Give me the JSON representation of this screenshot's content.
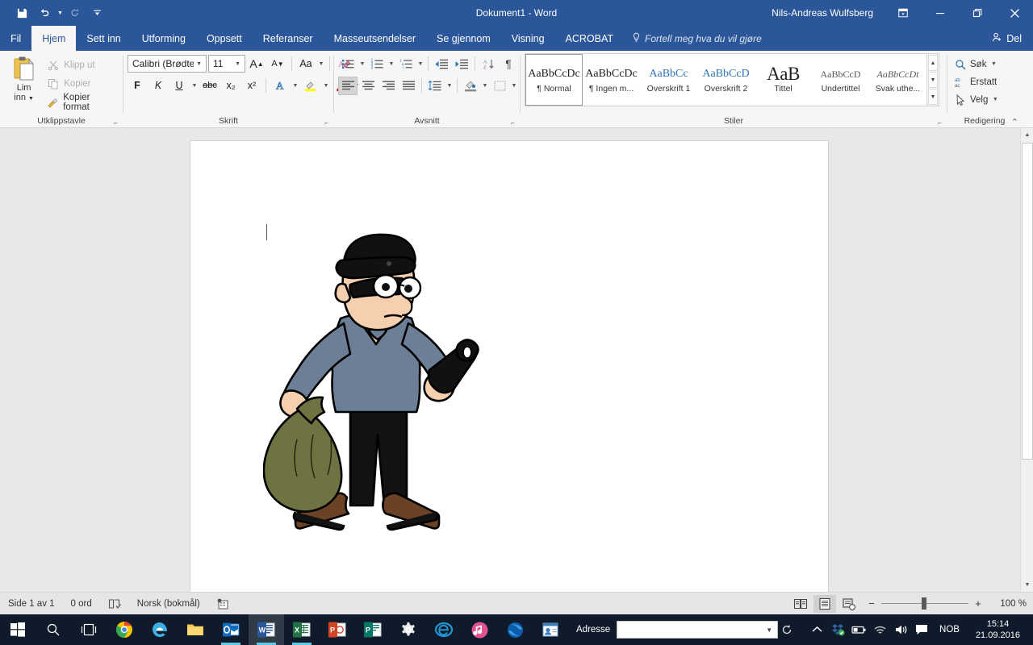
{
  "titlebar": {
    "document_title": "Dokument1 - Word",
    "user_name": "Nils-Andreas Wulfsberg",
    "qat": [
      {
        "name": "save",
        "label": "Lagre"
      },
      {
        "name": "undo",
        "label": "Angre"
      },
      {
        "name": "redo",
        "label": "Gjør om"
      },
      {
        "name": "customize",
        "label": "Tilpass verktøylinje for hurtigtilgang"
      }
    ],
    "window_buttons": [
      {
        "name": "ribbon-display-options",
        "label": "Alternativer for båndvisning"
      },
      {
        "name": "minimize",
        "label": "Minimer"
      },
      {
        "name": "restore",
        "label": "Gjenopprett"
      },
      {
        "name": "close",
        "label": "Lukk"
      }
    ]
  },
  "tabs": [
    {
      "label": "Fil",
      "active": false
    },
    {
      "label": "Hjem",
      "active": true
    },
    {
      "label": "Sett inn",
      "active": false
    },
    {
      "label": "Utforming",
      "active": false
    },
    {
      "label": "Oppsett",
      "active": false
    },
    {
      "label": "Referanser",
      "active": false
    },
    {
      "label": "Masseutsendelser",
      "active": false
    },
    {
      "label": "Se gjennom",
      "active": false
    },
    {
      "label": "Visning",
      "active": false
    },
    {
      "label": "ACROBAT",
      "active": false
    }
  ],
  "tell_me": "Fortell meg hva du vil gjøre",
  "share": "Del",
  "ribbon": {
    "clipboard": {
      "group_label": "Utklippstavle",
      "paste_label_line1": "Lim",
      "paste_label_line2": "inn",
      "cut": "Klipp ut",
      "copy": "Kopier",
      "format_painter": "Kopier format"
    },
    "font": {
      "group_label": "Skrift",
      "font_name": "Calibri (Brødte",
      "font_size": "11",
      "grow_font": "A",
      "shrink_font": "A",
      "change_case": "Aa",
      "clear_formatting": "Fjern all formatering",
      "bold": "F",
      "italic": "K",
      "underline": "U",
      "strikethrough": "abc",
      "subscript": "x₂",
      "superscript": "x²",
      "text_effects": "A",
      "highlight": "ab",
      "font_color": "A",
      "highlight_color": "#ffff00",
      "font_color_value": "#c00000"
    },
    "paragraph": {
      "group_label": "Avsnitt",
      "bullets": "Punktmerket liste",
      "numbering": "Nummerert liste",
      "multilevel": "Liste med flere nivåer",
      "decrease_indent": "Reduser innrykk",
      "increase_indent": "Øk innrykk",
      "sort": "Sorter",
      "show_marks": "¶",
      "align_left": "Venstrejuster",
      "align_center": "Midtstill",
      "align_right": "Høyrejuster",
      "justify": "Blokkjuster",
      "line_spacing": "Linje- og avsnittsavstand",
      "shading": "Skyggelegging",
      "borders": "Kantlinjer"
    },
    "styles": {
      "group_label": "Stiler",
      "items": [
        {
          "preview": "AaBbCcDc",
          "name": "¶ Normal",
          "style": "normal",
          "selected": true
        },
        {
          "preview": "AaBbCcDc",
          "name": "¶ Ingen m...",
          "style": "normal",
          "selected": false
        },
        {
          "preview": "AaBbCc",
          "name": "Overskrift 1",
          "style": "blue",
          "selected": false
        },
        {
          "preview": "AaBbCcD",
          "name": "Overskrift 2",
          "style": "blue",
          "selected": false
        },
        {
          "preview": "AaB",
          "name": "Tittel",
          "style": "big",
          "selected": false
        },
        {
          "preview": "AaBbCcD",
          "name": "Undertittel",
          "style": "gray",
          "selected": false
        },
        {
          "preview": "AaBbCcDt",
          "name": "Svak uthe...",
          "style": "ital",
          "selected": false
        }
      ],
      "scroll_up": "▲",
      "scroll_down": "▼",
      "more": "▾"
    },
    "editing": {
      "group_label": "Redigering",
      "find": "Søk",
      "replace": "Erstatt",
      "select": "Velg"
    },
    "collapse": "Skjul båndet"
  },
  "document": {
    "clipart_name": "burglar-with-sack-and-flashlight",
    "colors": {
      "hat": "#0d0d0d",
      "skin": "#f5cfae",
      "sweater": "#6d7f96",
      "pants": "#121212",
      "sack": "#6f7341",
      "shoes": "#6b4226",
      "flashlight": "#111111"
    }
  },
  "statusbar": {
    "page_info": "Side 1 av 1",
    "word_count": "0 ord",
    "proofing_icon": "proofing-errors-icon",
    "language": "Norsk (bokmål)",
    "macro_icon": "macro-record-icon",
    "views": [
      {
        "name": "read-mode",
        "selected": false
      },
      {
        "name": "print-layout",
        "selected": true
      },
      {
        "name": "web-layout",
        "selected": false
      }
    ],
    "zoom_out": "−",
    "zoom_in": "+",
    "zoom_level": "100 %",
    "zoom_value": 100
  },
  "taskbar": {
    "items": [
      {
        "name": "start-button",
        "label": "Start",
        "active": false,
        "running": false
      },
      {
        "name": "search-icon",
        "label": "Søk",
        "active": false,
        "running": false
      },
      {
        "name": "task-view-icon",
        "label": "Oppgavevisning",
        "active": false,
        "running": false
      },
      {
        "name": "chrome-icon",
        "label": "Google Chrome",
        "active": false,
        "running": false
      },
      {
        "name": "edge-icon",
        "label": "Microsoft Edge",
        "active": false,
        "running": false
      },
      {
        "name": "file-explorer-icon",
        "label": "Filutforsker",
        "active": false,
        "running": false
      },
      {
        "name": "outlook-icon",
        "label": "Outlook",
        "active": false,
        "running": true
      },
      {
        "name": "word-icon",
        "label": "Word",
        "active": true,
        "running": true
      },
      {
        "name": "excel-icon",
        "label": "Excel",
        "active": false,
        "running": true
      },
      {
        "name": "powerpoint-icon",
        "label": "PowerPoint",
        "active": false,
        "running": false
      },
      {
        "name": "publisher-icon",
        "label": "Publisher",
        "active": false,
        "running": false
      },
      {
        "name": "settings-icon",
        "label": "Innstillinger",
        "active": false,
        "running": false
      },
      {
        "name": "internet-explorer-icon",
        "label": "Internet Explorer",
        "active": false,
        "running": false
      },
      {
        "name": "itunes-icon",
        "label": "iTunes",
        "active": false,
        "running": false
      },
      {
        "name": "skype-icon",
        "label": "Skype",
        "active": false,
        "running": false
      },
      {
        "name": "contacts-icon",
        "label": "Kontakter",
        "active": false,
        "running": false
      }
    ],
    "address_label": "Adresse",
    "address_value": "",
    "tray": [
      {
        "name": "show-hidden-icons",
        "glyph": "∧"
      },
      {
        "name": "dropbox-icon",
        "glyph": ""
      },
      {
        "name": "battery-icon",
        "glyph": ""
      },
      {
        "name": "wifi-icon",
        "glyph": ""
      },
      {
        "name": "volume-icon",
        "glyph": ""
      },
      {
        "name": "action-center-icon",
        "glyph": ""
      }
    ],
    "language": "NOB",
    "time": "15:14",
    "date": "21.09.2016"
  }
}
